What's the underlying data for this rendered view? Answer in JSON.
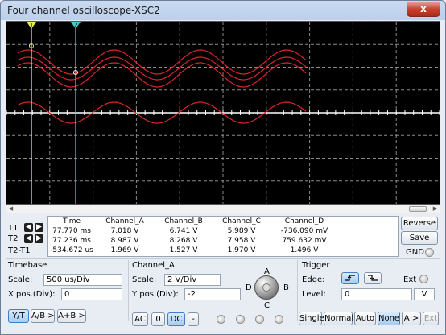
{
  "window": {
    "title": "Four channel oscilloscope-XSC2",
    "close_glyph": "x"
  },
  "scope": {
    "background": "#000000",
    "grid_color": "#8a8a8a",
    "trace_color": "#d8262b",
    "baseline_color": "#ffffff",
    "cursor1": {
      "label": "1",
      "color": "#e8e85a"
    },
    "cursor2": {
      "label": "2",
      "color": "#3ad2c6"
    }
  },
  "readout": {
    "row_labels": [
      "T1",
      "T2",
      "T2-T1"
    ],
    "headers": [
      "Time",
      "Channel_A",
      "Channel_B",
      "Channel_C",
      "Channel_D"
    ],
    "rows": [
      [
        "77.770 ms",
        "7.018 V",
        "6.741 V",
        "5.989 V",
        "-736.090 mV"
      ],
      [
        "77.236 ms",
        "8.987 V",
        "8.268 V",
        "7.958 V",
        "759.632 mV"
      ],
      [
        "-534.672 us",
        "1.969 V",
        "1.527 V",
        "1.970 V",
        "1.496 V"
      ]
    ]
  },
  "buttons": {
    "reverse": "Reverse",
    "save": "Save",
    "gnd": "GND"
  },
  "timebase": {
    "title": "Timebase",
    "scale_label": "Scale:",
    "scale_value": "500 us/Div",
    "xpos_label": "X pos.(Div):",
    "xpos_value": "0",
    "mode_buttons": [
      "Y/T",
      "A/B >",
      "A+B >"
    ]
  },
  "channel": {
    "title": "Channel_A",
    "scale_label": "Scale:",
    "scale_value": "2  V/Div",
    "ypos_label": "Y pos.(Div):",
    "ypos_value": "-2",
    "coupling_buttons": [
      "AC",
      "0",
      "DC",
      "-"
    ]
  },
  "selector": {
    "labels": [
      "A",
      "B",
      "C",
      "D"
    ]
  },
  "trigger": {
    "title": "Trigger",
    "edge_label": "Edge:",
    "ext_label": "Ext",
    "level_label": "Level:",
    "level_value": "0",
    "level_unit": "V",
    "mode_buttons": [
      "Single",
      "Normal",
      "Auto",
      "None",
      "A >",
      "Ext"
    ]
  }
}
